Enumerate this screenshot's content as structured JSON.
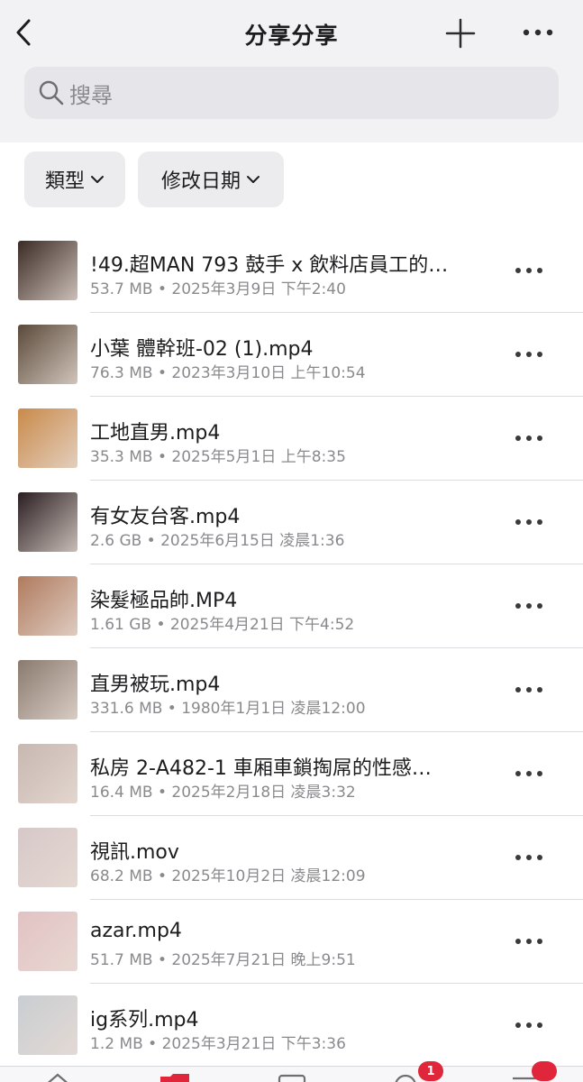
{
  "header": {
    "title": "分享分享",
    "back_icon": "chevron-left-icon",
    "add_icon": "plus-icon",
    "more_icon": "ellipsis-icon"
  },
  "search": {
    "placeholder": "搜尋"
  },
  "filters": [
    {
      "label": "類型"
    },
    {
      "label": "修改日期"
    }
  ],
  "files": [
    {
      "name": "!49.超MAN 793 鼓手 x 飲料店員工的…",
      "meta": "53.7 MB • 2025年3月9日 下午2:40",
      "thumb_color": "#3a2b24"
    },
    {
      "name": "小葉 體幹班-02 (1).mp4",
      "meta": "76.3 MB • 2023年3月10日 上午10:54",
      "thumb_color": "#5a4a3a"
    },
    {
      "name": "工地直男.mp4",
      "meta": "35.3 MB • 2025年5月1日 上午8:35",
      "thumb_color": "#c98a4a"
    },
    {
      "name": "有女友台客.mp4",
      "meta": "2.6 GB • 2025年6月15日 凌晨1:36",
      "thumb_color": "#2a1e22"
    },
    {
      "name": "染髮極品帥.MP4",
      "meta": "1.61 GB • 2025年4月21日 下午4:52",
      "thumb_color": "#b07a5e"
    },
    {
      "name": "直男被玩.mp4",
      "meta": "331.6 MB • 1980年1月1日 凌晨12:00",
      "thumb_color": "#8a7a6e"
    },
    {
      "name": "私房 2-A482-1 車厢車鎖掏屌的性感…",
      "meta": "16.4 MB • 2025年2月18日 凌晨3:32",
      "thumb_color": "#c7b8b0"
    },
    {
      "name": "視訊.mov",
      "meta": "68.2 MB • 2025年10月2日 凌晨12:09",
      "thumb_color": "#d6c8c8"
    },
    {
      "name": "azar.mp4",
      "meta": "51.7 MB • 2025年7月21日 晚上9:51",
      "thumb_color": "#e2c2c4"
    },
    {
      "name": "ig系列.mp4",
      "meta": "1.2 MB • 2025年3月21日 下午3:36",
      "thumb_color": "#c9cdd2"
    }
  ],
  "tabbar": {
    "badges": [
      "1",
      ""
    ],
    "accent": "#e0263a"
  }
}
